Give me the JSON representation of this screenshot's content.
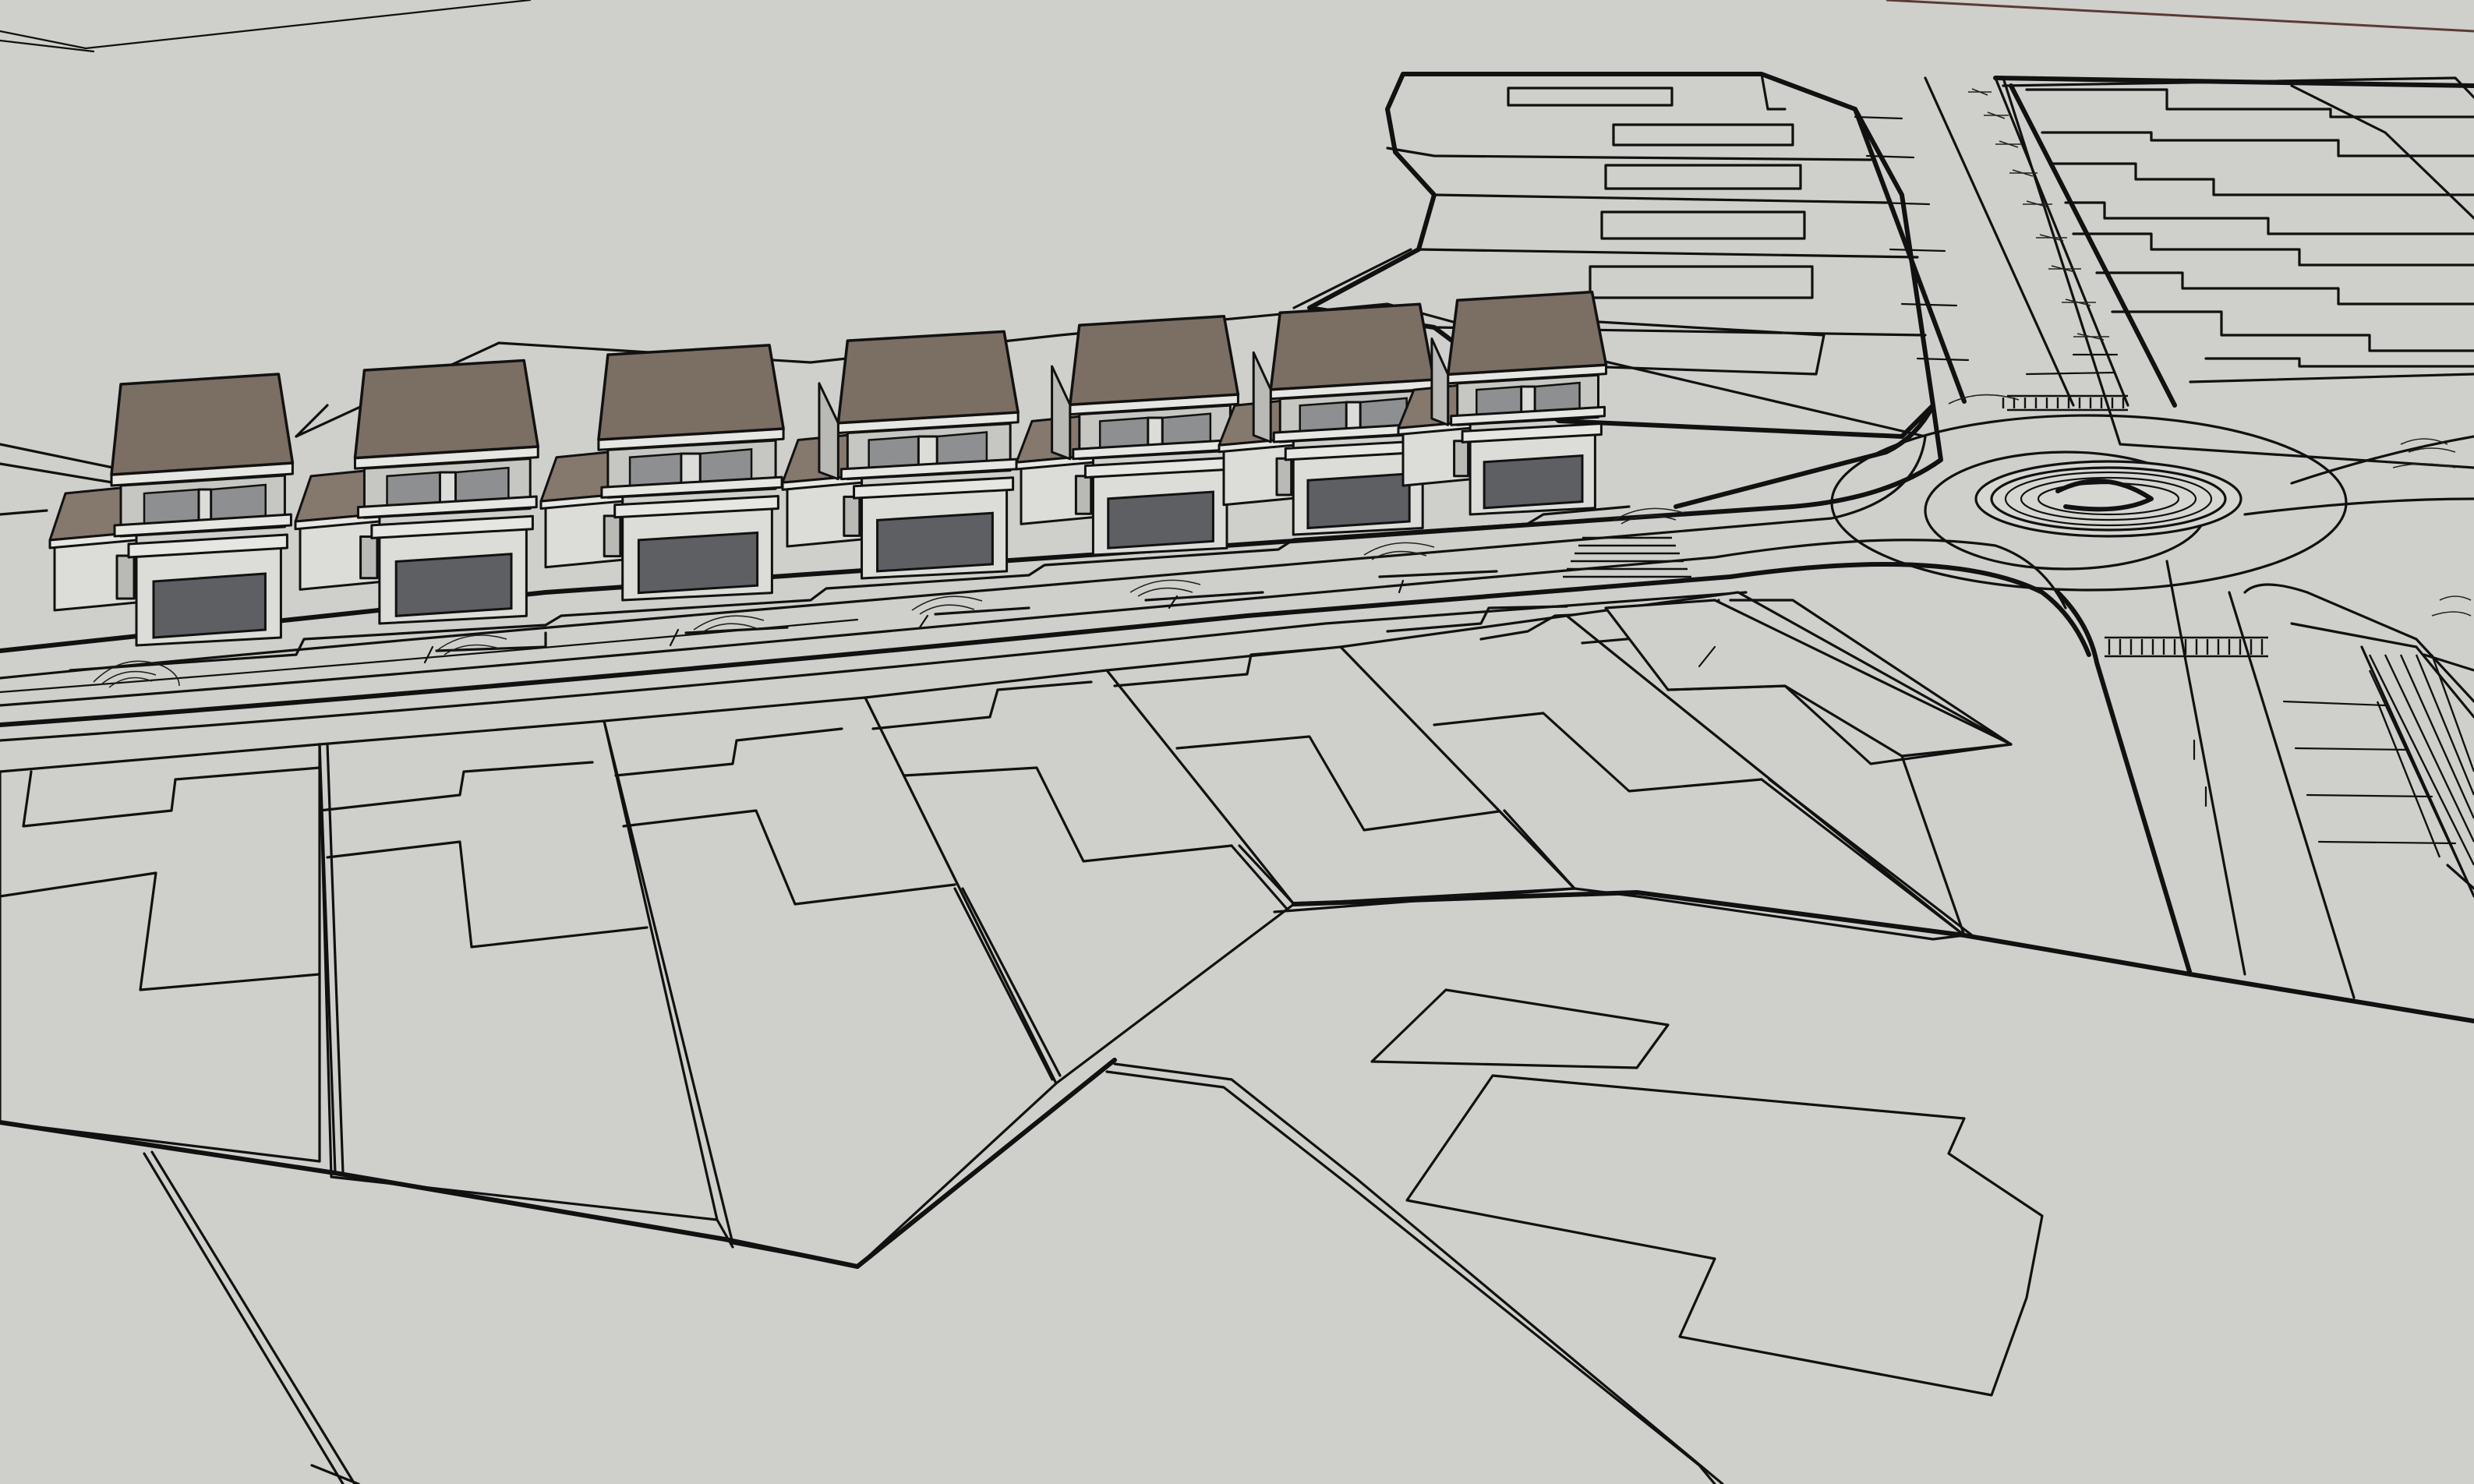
{
  "viewport": {
    "background_color": "#cfcfcb",
    "line_color": "#111111",
    "roof_color": "#7b6e63",
    "garage_color": "#5d5f63",
    "wall_color": "#dcdcd8"
  },
  "scene": {
    "houses_count": 7,
    "roundabout_visible": true,
    "crosswalks_count": 3
  }
}
